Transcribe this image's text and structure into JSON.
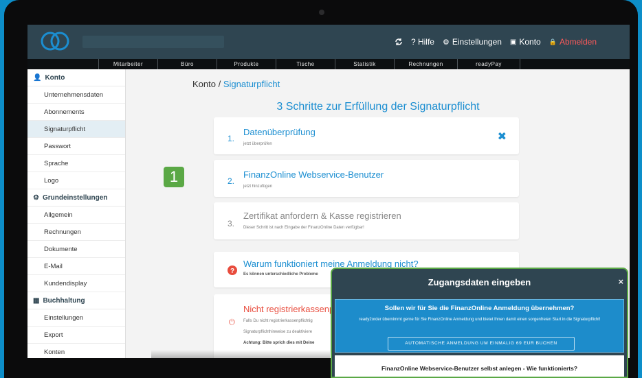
{
  "topbar": {
    "nav": [
      {
        "icon": "refresh-icon",
        "label": ""
      },
      {
        "icon": "help-icon",
        "label": "? Hilfe"
      },
      {
        "icon": "gear-icon",
        "label": "Einstellungen"
      },
      {
        "icon": "account-icon",
        "label": "Konto"
      },
      {
        "icon": "lock-icon",
        "label": "Abmelden"
      }
    ]
  },
  "menu": [
    "Mitarbeiter",
    "Büro",
    "Produkte",
    "Tische",
    "Statistik",
    "Rechnungen",
    "readyPay"
  ],
  "sidebar": {
    "sections": [
      {
        "title": "Konto",
        "icon": "user-icon",
        "items": [
          "Unternehmensdaten",
          "Abonnements",
          "Signaturpflicht",
          "Passwort",
          "Sprache",
          "Logo"
        ]
      },
      {
        "title": "Grundeinstellungen",
        "icon": "gears-icon",
        "items": [
          "Allgemein",
          "Rechnungen",
          "Dokumente",
          "E-Mail",
          "Kundendisplay"
        ]
      },
      {
        "title": "Buchhaltung",
        "icon": "calculator-icon",
        "items": [
          "Einstellungen",
          "Export",
          "Konten"
        ]
      }
    ],
    "active": "Signaturpflicht"
  },
  "breadcrumb": {
    "root": "Konto",
    "sep": " / ",
    "current": "Signaturpflicht"
  },
  "page_title": "3 Schritte zur Erfüllung der Signaturpflicht",
  "steps": [
    {
      "num": "1.",
      "title": "Datenüberprüfung",
      "sub": "jetzt überprüfen"
    },
    {
      "num": "2.",
      "title": "FinanzOnline Webservice-Benutzer",
      "sub": "jetzt hinzufügen"
    },
    {
      "num": "3.",
      "title": "Zertifikat anfordern & Kasse registrieren",
      "sub": "Dieser Schritt ist nach Eingabe der FinanzOnline Daten verfügbar!"
    }
  ],
  "badge": "1",
  "warn": {
    "title": "Warum funktioniert meine Anmeldung nicht?",
    "sub": "Es können unterschiedliche Probleme"
  },
  "not_registered": {
    "title": "Nicht registrierkassenp",
    "line1": "Falls Du nicht registrierkassenpflichtig",
    "line2": "Signaturpflichthinweise zu deaktiviere",
    "line3": "Achtung: Bitte sprich dies mit Deine"
  },
  "modal": {
    "title": "Zugangsdaten eingeben",
    "close": "×",
    "offer_title": "Sollen wir für Sie die FinanzOnline Anmeldung übernehmen?",
    "offer_text": "ready2order übernimmt gerne für Sie FinanzOnline Anmeldung und bietet Ihnen damit einen sorgenfreien Start in die Signaturpflicht!",
    "offer_button": "AUTOMATISCHE ANMELDUNG UM EINMALIG 69 EUR BUCHEN",
    "howto_title": "FinanzOnline Webservice-Benutzer selbst anlegen - Wie funktionierts?"
  },
  "colors": {
    "accent": "#1b8ed1",
    "header": "#2f4551",
    "green": "#5aa845",
    "danger": "#e84c3d"
  }
}
